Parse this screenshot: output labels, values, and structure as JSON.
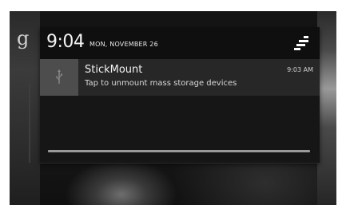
{
  "launcher": {
    "google_logo": "g"
  },
  "status": {
    "time": "9:04",
    "date": "MON, NOVEMBER 26"
  },
  "notification": {
    "title": "StickMount",
    "text": "Tap to unmount mass storage devices",
    "time": "9:03 AM",
    "icon": "usb-icon"
  },
  "icons": {
    "settings_toggle": "quick-settings-icon"
  }
}
